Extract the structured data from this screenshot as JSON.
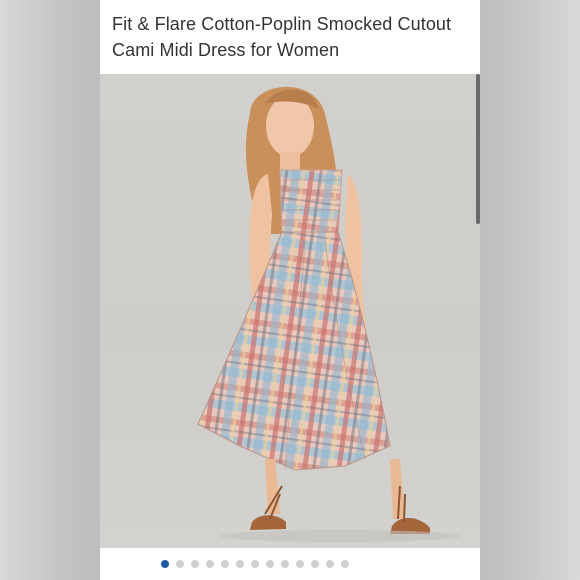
{
  "product": {
    "title": "Fit & Flare Cotton-Poplin Smocked Cutout Cami Midi Dress for Women"
  },
  "gallery": {
    "image_count": 13,
    "active_index": 0,
    "colors": {
      "active_dot": "#1e5aa8",
      "inactive_dot": "#cfcfcf"
    }
  }
}
